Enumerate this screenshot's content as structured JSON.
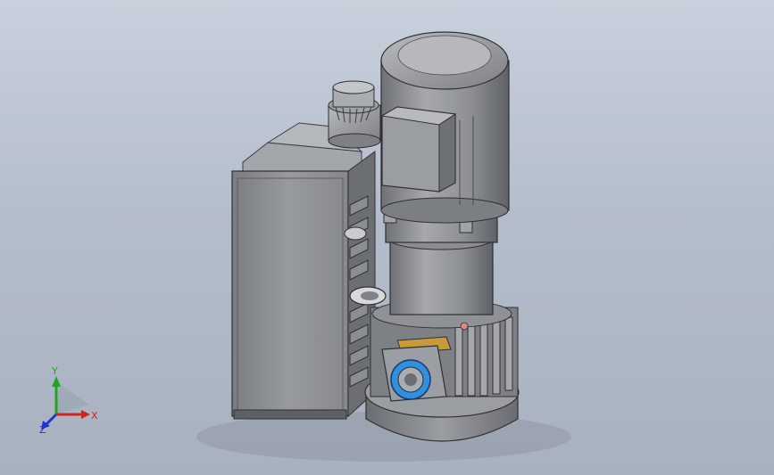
{
  "viewport": {
    "background_top": "#c8d0dc",
    "background_bottom": "#a8b1bf"
  },
  "model": {
    "body_color": "#8c8f93",
    "shadow_color": "#5e6166",
    "highlight_color": "#c4c6c9",
    "accent_blue": "#2f8fe0",
    "accent_orange": "#c79a3a",
    "accent_pink": "#d98b8b"
  },
  "triad": {
    "x_label": "X",
    "y_label": "Y",
    "z_label": "Z",
    "x_color": "#d32222",
    "y_color": "#22a322",
    "z_color": "#2233cc"
  }
}
